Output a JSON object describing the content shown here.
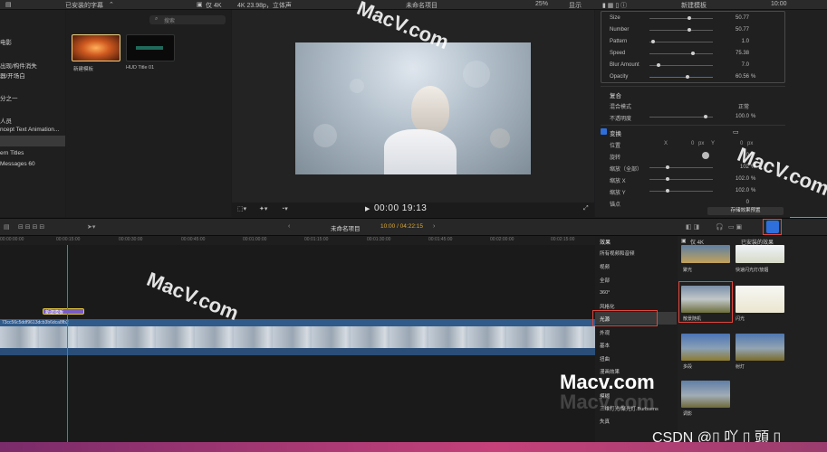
{
  "topbar": {
    "browser_filter": "已安装的字幕",
    "only_4k_label": "仅 4K",
    "format": "4K 23.98p，立体声",
    "project_name": "未命名项目",
    "zoom": "25%",
    "display_label": "显示",
    "inspector_title": "新建模板",
    "inspector_time": "10:00"
  },
  "library": {
    "items": [
      "电影",
      "出现/构件消失",
      "器/开场白",
      "分之一",
      "人员",
      "ncept Text Animation...",
      "",
      "ern Titles",
      "Messages 60"
    ]
  },
  "browser": {
    "search_placeholder": "搜索",
    "thumbs": [
      {
        "label": "新建模板"
      },
      {
        "label": "HUD Title 01"
      }
    ]
  },
  "viewer": {
    "timecode": "00:00 19:13"
  },
  "inspector": {
    "params": [
      {
        "label": "Size",
        "value": "50.77",
        "unit": ""
      },
      {
        "label": "Number",
        "value": "50.77",
        "unit": ""
      },
      {
        "label": "Pattern",
        "value": "1.0",
        "unit": ""
      },
      {
        "label": "Speed",
        "value": "75.38",
        "unit": ""
      },
      {
        "label": "Blur Amount",
        "value": "7.0",
        "unit": ""
      },
      {
        "label": "Opacity",
        "value": "60.56",
        "unit": "%"
      }
    ],
    "compositing_title": "复合",
    "blend_label": "混合模式",
    "blend_value": "正常",
    "opacity_label": "不透明度",
    "opacity_value": "100.0",
    "opacity_unit": "%",
    "transform_title": "变换",
    "position_label": "位置",
    "position_x": "0",
    "position_unit": "px",
    "rotation_label": "旋转",
    "rotation_value": "0",
    "scale_all_label": "缩放（全部）",
    "scale_all_value": "102",
    "scale_x_label": "缩放 X",
    "scale_x_value": "102.0",
    "scale_y_label": "缩放 Y",
    "scale_y_value": "102.0",
    "anchor_label": "锚点",
    "anchor_value": "0",
    "save_preset_label": "存储效果预置",
    "axis_x": "X",
    "axis_y": "Y"
  },
  "timeline": {
    "project_name": "未命名项目",
    "timecode": "10:00 / 04:22:15",
    "ruler": [
      "00:00:00:00",
      "00:00:15:00",
      "00:00:30:00",
      "00:00:45:00",
      "00:01:00:00",
      "00:01:15:00",
      "00:01:30:00",
      "00:01:45:00",
      "00:02:00:00",
      "00:02:15:00"
    ],
    "title_clip": "新建模板",
    "clip_name": "73cc56c5ddf9613dcb3b6dca8fb2"
  },
  "effects": {
    "header": "效果",
    "only_4k": "仅 4K",
    "installed": "已安装的效果",
    "categories": [
      "所有视频和音频",
      "视频",
      "全部",
      "360°",
      "风格化",
      "光源",
      "外观",
      "基本",
      "扭曲",
      "漫画效果",
      "模糊",
      "三维灯光/聚光灯.Burbsens",
      "失真"
    ],
    "selected_category": "光源",
    "items": [
      {
        "label": "聚光"
      },
      {
        "label": "快速闪光灯/放烟"
      },
      {
        "label": "散景随机"
      },
      {
        "label": "闪光"
      },
      {
        "label": "多段"
      },
      {
        "label": "射灯"
      },
      {
        "label": "调影"
      }
    ]
  },
  "watermarks": {
    "macv_com": "MacV.com",
    "macv_dot": "Macv.com",
    "macv_sub": "Macv.com",
    "csdn": "CSDN @▯ 吖 ▯ 頭 ▯"
  },
  "colors": {
    "accent_red": "#e0463c",
    "accent_blue": "#2f6fdc",
    "clip_blue": "#3a6a9e",
    "title_purple": "#7b5cc0"
  }
}
